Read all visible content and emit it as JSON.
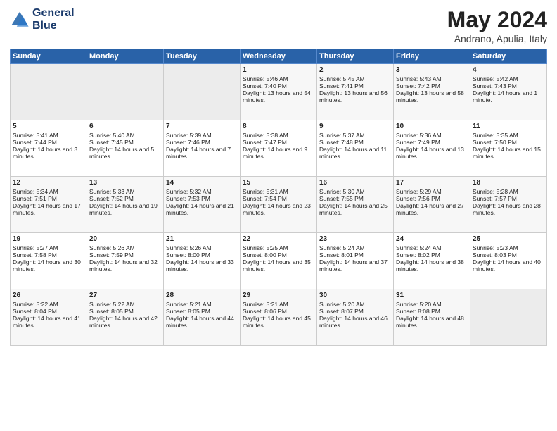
{
  "header": {
    "logo_line1": "General",
    "logo_line2": "Blue",
    "month": "May 2024",
    "location": "Andrano, Apulia, Italy"
  },
  "days_of_week": [
    "Sunday",
    "Monday",
    "Tuesday",
    "Wednesday",
    "Thursday",
    "Friday",
    "Saturday"
  ],
  "weeks": [
    [
      {
        "day": "",
        "empty": true
      },
      {
        "day": "",
        "empty": true
      },
      {
        "day": "",
        "empty": true
      },
      {
        "day": "1",
        "sunrise": "Sunrise: 5:46 AM",
        "sunset": "Sunset: 7:40 PM",
        "daylight": "Daylight: 13 hours and 54 minutes."
      },
      {
        "day": "2",
        "sunrise": "Sunrise: 5:45 AM",
        "sunset": "Sunset: 7:41 PM",
        "daylight": "Daylight: 13 hours and 56 minutes."
      },
      {
        "day": "3",
        "sunrise": "Sunrise: 5:43 AM",
        "sunset": "Sunset: 7:42 PM",
        "daylight": "Daylight: 13 hours and 58 minutes."
      },
      {
        "day": "4",
        "sunrise": "Sunrise: 5:42 AM",
        "sunset": "Sunset: 7:43 PM",
        "daylight": "Daylight: 14 hours and 1 minute."
      }
    ],
    [
      {
        "day": "5",
        "sunrise": "Sunrise: 5:41 AM",
        "sunset": "Sunset: 7:44 PM",
        "daylight": "Daylight: 14 hours and 3 minutes."
      },
      {
        "day": "6",
        "sunrise": "Sunrise: 5:40 AM",
        "sunset": "Sunset: 7:45 PM",
        "daylight": "Daylight: 14 hours and 5 minutes."
      },
      {
        "day": "7",
        "sunrise": "Sunrise: 5:39 AM",
        "sunset": "Sunset: 7:46 PM",
        "daylight": "Daylight: 14 hours and 7 minutes."
      },
      {
        "day": "8",
        "sunrise": "Sunrise: 5:38 AM",
        "sunset": "Sunset: 7:47 PM",
        "daylight": "Daylight: 14 hours and 9 minutes."
      },
      {
        "day": "9",
        "sunrise": "Sunrise: 5:37 AM",
        "sunset": "Sunset: 7:48 PM",
        "daylight": "Daylight: 14 hours and 11 minutes."
      },
      {
        "day": "10",
        "sunrise": "Sunrise: 5:36 AM",
        "sunset": "Sunset: 7:49 PM",
        "daylight": "Daylight: 14 hours and 13 minutes."
      },
      {
        "day": "11",
        "sunrise": "Sunrise: 5:35 AM",
        "sunset": "Sunset: 7:50 PM",
        "daylight": "Daylight: 14 hours and 15 minutes."
      }
    ],
    [
      {
        "day": "12",
        "sunrise": "Sunrise: 5:34 AM",
        "sunset": "Sunset: 7:51 PM",
        "daylight": "Daylight: 14 hours and 17 minutes."
      },
      {
        "day": "13",
        "sunrise": "Sunrise: 5:33 AM",
        "sunset": "Sunset: 7:52 PM",
        "daylight": "Daylight: 14 hours and 19 minutes."
      },
      {
        "day": "14",
        "sunrise": "Sunrise: 5:32 AM",
        "sunset": "Sunset: 7:53 PM",
        "daylight": "Daylight: 14 hours and 21 minutes."
      },
      {
        "day": "15",
        "sunrise": "Sunrise: 5:31 AM",
        "sunset": "Sunset: 7:54 PM",
        "daylight": "Daylight: 14 hours and 23 minutes."
      },
      {
        "day": "16",
        "sunrise": "Sunrise: 5:30 AM",
        "sunset": "Sunset: 7:55 PM",
        "daylight": "Daylight: 14 hours and 25 minutes."
      },
      {
        "day": "17",
        "sunrise": "Sunrise: 5:29 AM",
        "sunset": "Sunset: 7:56 PM",
        "daylight": "Daylight: 14 hours and 27 minutes."
      },
      {
        "day": "18",
        "sunrise": "Sunrise: 5:28 AM",
        "sunset": "Sunset: 7:57 PM",
        "daylight": "Daylight: 14 hours and 28 minutes."
      }
    ],
    [
      {
        "day": "19",
        "sunrise": "Sunrise: 5:27 AM",
        "sunset": "Sunset: 7:58 PM",
        "daylight": "Daylight: 14 hours and 30 minutes."
      },
      {
        "day": "20",
        "sunrise": "Sunrise: 5:26 AM",
        "sunset": "Sunset: 7:59 PM",
        "daylight": "Daylight: 14 hours and 32 minutes."
      },
      {
        "day": "21",
        "sunrise": "Sunrise: 5:26 AM",
        "sunset": "Sunset: 8:00 PM",
        "daylight": "Daylight: 14 hours and 33 minutes."
      },
      {
        "day": "22",
        "sunrise": "Sunrise: 5:25 AM",
        "sunset": "Sunset: 8:00 PM",
        "daylight": "Daylight: 14 hours and 35 minutes."
      },
      {
        "day": "23",
        "sunrise": "Sunrise: 5:24 AM",
        "sunset": "Sunset: 8:01 PM",
        "daylight": "Daylight: 14 hours and 37 minutes."
      },
      {
        "day": "24",
        "sunrise": "Sunrise: 5:24 AM",
        "sunset": "Sunset: 8:02 PM",
        "daylight": "Daylight: 14 hours and 38 minutes."
      },
      {
        "day": "25",
        "sunrise": "Sunrise: 5:23 AM",
        "sunset": "Sunset: 8:03 PM",
        "daylight": "Daylight: 14 hours and 40 minutes."
      }
    ],
    [
      {
        "day": "26",
        "sunrise": "Sunrise: 5:22 AM",
        "sunset": "Sunset: 8:04 PM",
        "daylight": "Daylight: 14 hours and 41 minutes."
      },
      {
        "day": "27",
        "sunrise": "Sunrise: 5:22 AM",
        "sunset": "Sunset: 8:05 PM",
        "daylight": "Daylight: 14 hours and 42 minutes."
      },
      {
        "day": "28",
        "sunrise": "Sunrise: 5:21 AM",
        "sunset": "Sunset: 8:05 PM",
        "daylight": "Daylight: 14 hours and 44 minutes."
      },
      {
        "day": "29",
        "sunrise": "Sunrise: 5:21 AM",
        "sunset": "Sunset: 8:06 PM",
        "daylight": "Daylight: 14 hours and 45 minutes."
      },
      {
        "day": "30",
        "sunrise": "Sunrise: 5:20 AM",
        "sunset": "Sunset: 8:07 PM",
        "daylight": "Daylight: 14 hours and 46 minutes."
      },
      {
        "day": "31",
        "sunrise": "Sunrise: 5:20 AM",
        "sunset": "Sunset: 8:08 PM",
        "daylight": "Daylight: 14 hours and 48 minutes."
      },
      {
        "day": "",
        "empty": true
      }
    ]
  ]
}
